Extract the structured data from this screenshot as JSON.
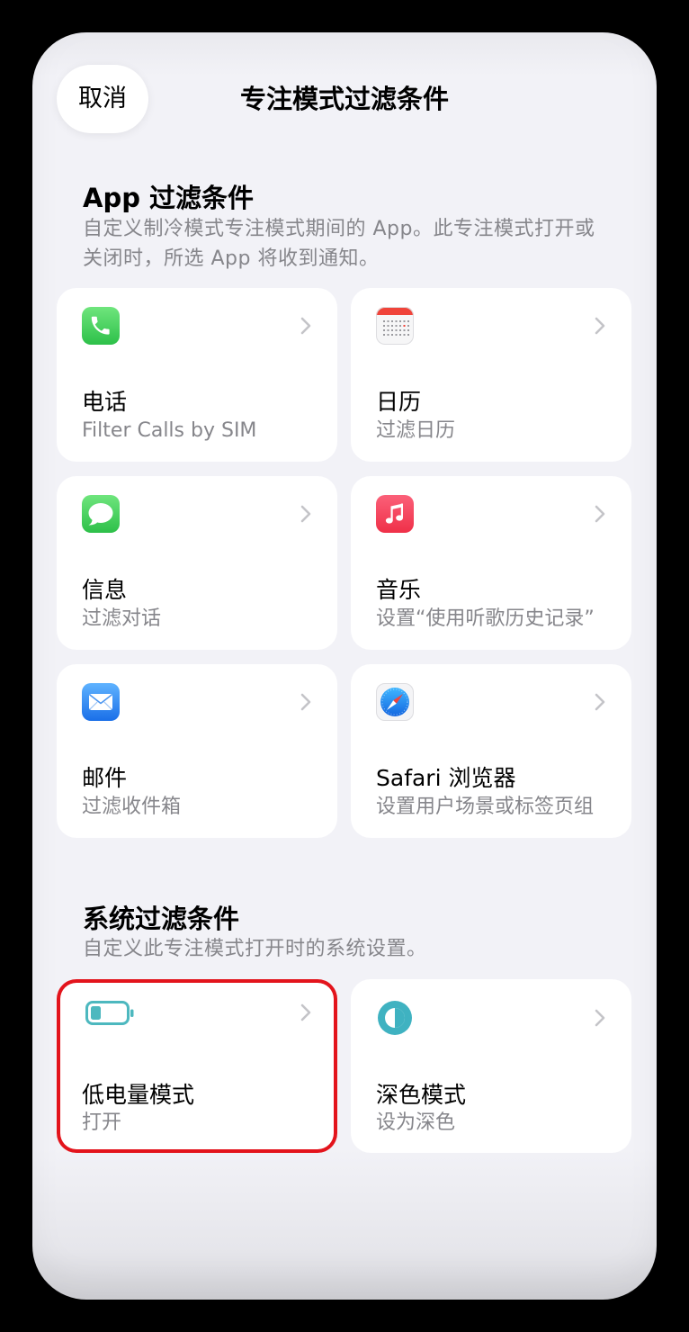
{
  "header": {
    "cancel_label": "取消",
    "title": "专注模式过滤条件"
  },
  "app_filters": {
    "title": "App 过滤条件",
    "description": "自定义制冷模式专注模式期间的 App。此专注模式打开或关闭时，所选 App 将收到通知。",
    "items": [
      {
        "icon": "phone-icon",
        "title": "电话",
        "subtitle": "Filter Calls by SIM"
      },
      {
        "icon": "calendar-icon",
        "title": "日历",
        "subtitle": "过滤日历"
      },
      {
        "icon": "messages-icon",
        "title": "信息",
        "subtitle": "过滤对话"
      },
      {
        "icon": "music-icon",
        "title": "音乐",
        "subtitle": "设置“使用听歌历史记录”"
      },
      {
        "icon": "mail-icon",
        "title": "邮件",
        "subtitle": "过滤收件箱"
      },
      {
        "icon": "safari-icon",
        "title": "Safari 浏览器",
        "subtitle": "设置用户场景或标签页组"
      }
    ]
  },
  "system_filters": {
    "title": "系统过滤条件",
    "description": "自定义此专注模式打开时的系统设置。",
    "items": [
      {
        "icon": "low-battery-icon",
        "title": "低电量模式",
        "subtitle": "打开",
        "highlighted": true
      },
      {
        "icon": "dark-mode-icon",
        "title": "深色模式",
        "subtitle": "设为深色",
        "highlighted": false
      }
    ]
  },
  "colors": {
    "sheet_background": "#f2f2f7",
    "card_background": "#ffffff",
    "primary_text": "#000000",
    "secondary_text": "#86868b",
    "chevron": "#c4c4c8",
    "accent_teal": "#4db8bf",
    "highlight_border": "#e3141c"
  }
}
